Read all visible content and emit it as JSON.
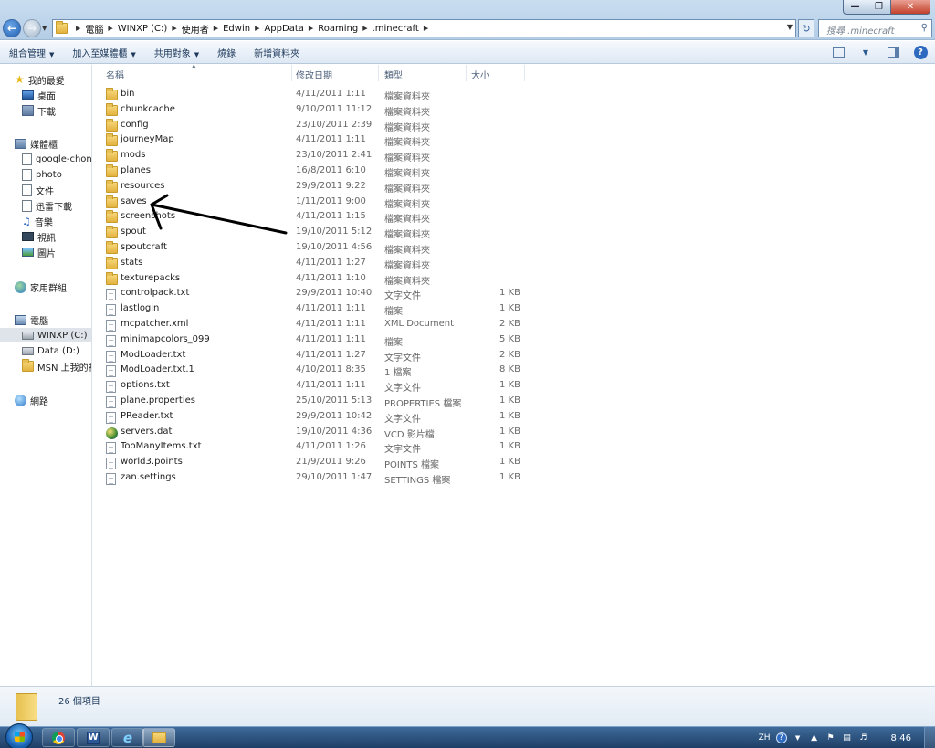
{
  "window": {
    "breadcrumb": [
      "電腦",
      "WINXP (C:)",
      "使用者",
      "Edwin",
      "AppData",
      "Roaming",
      ".minecraft"
    ],
    "search_placeholder": "搜尋 .minecraft"
  },
  "toolbar": {
    "organize": "組合管理",
    "add_to_library": "加入至媒體櫃",
    "share_with": "共用對象",
    "burn": "燒錄",
    "new_folder": "新增資料夾"
  },
  "nav": {
    "favorites": "我的最愛",
    "desktop": "桌面",
    "downloads": "下載",
    "libraries": "媒體櫃",
    "lib_items": [
      "google-chon",
      "photo",
      "文件",
      "迅雷下載",
      "音樂",
      "視訊",
      "圖片"
    ],
    "homegroup": "家用群組",
    "computer": "電腦",
    "drives": [
      "WINXP (C:)",
      "Data (D:)",
      "MSN 上我的社"
    ],
    "network": "網路"
  },
  "columns": {
    "name": "名稱",
    "date": "修改日期",
    "type": "類型",
    "size": "大小"
  },
  "files": [
    {
      "icon": "folder-icon",
      "name": "bin",
      "date": "4/11/2011 1:11",
      "type": "檔案資料夾",
      "size": ""
    },
    {
      "icon": "folder-icon",
      "name": "chunkcache",
      "date": "9/10/2011 11:12",
      "type": "檔案資料夾",
      "size": ""
    },
    {
      "icon": "folder-icon",
      "name": "config",
      "date": "23/10/2011 2:39",
      "type": "檔案資料夾",
      "size": ""
    },
    {
      "icon": "folder-icon",
      "name": "journeyMap",
      "date": "4/11/2011 1:11",
      "type": "檔案資料夾",
      "size": ""
    },
    {
      "icon": "folder-icon",
      "name": "mods",
      "date": "23/10/2011 2:41",
      "type": "檔案資料夾",
      "size": ""
    },
    {
      "icon": "folder-icon",
      "name": "planes",
      "date": "16/8/2011 6:10",
      "type": "檔案資料夾",
      "size": ""
    },
    {
      "icon": "folder-icon",
      "name": "resources",
      "date": "29/9/2011 9:22",
      "type": "檔案資料夾",
      "size": ""
    },
    {
      "icon": "folder-icon",
      "name": "saves",
      "date": "1/11/2011 9:00",
      "type": "檔案資料夾",
      "size": ""
    },
    {
      "icon": "folder-icon",
      "name": "screenshots",
      "date": "4/11/2011 1:15",
      "type": "檔案資料夾",
      "size": ""
    },
    {
      "icon": "folder-icon",
      "name": "spout",
      "date": "19/10/2011 5:12",
      "type": "檔案資料夾",
      "size": ""
    },
    {
      "icon": "folder-icon",
      "name": "spoutcraft",
      "date": "19/10/2011 4:56",
      "type": "檔案資料夾",
      "size": ""
    },
    {
      "icon": "folder-icon",
      "name": "stats",
      "date": "4/11/2011 1:27",
      "type": "檔案資料夾",
      "size": ""
    },
    {
      "icon": "folder-icon",
      "name": "texturepacks",
      "date": "4/11/2011 1:10",
      "type": "檔案資料夾",
      "size": ""
    },
    {
      "icon": "file-icon",
      "name": "controlpack.txt",
      "date": "29/9/2011 10:40",
      "type": "文字文件",
      "size": "1 KB"
    },
    {
      "icon": "file-icon",
      "name": "lastlogin",
      "date": "4/11/2011 1:11",
      "type": "檔案",
      "size": "1 KB"
    },
    {
      "icon": "file-icon",
      "name": "mcpatcher.xml",
      "date": "4/11/2011 1:11",
      "type": "XML Document",
      "size": "2 KB"
    },
    {
      "icon": "file-icon",
      "name": "minimapcolors_099",
      "date": "4/11/2011 1:11",
      "type": "檔案",
      "size": "5 KB"
    },
    {
      "icon": "file-icon",
      "name": "ModLoader.txt",
      "date": "4/11/2011 1:27",
      "type": "文字文件",
      "size": "2 KB"
    },
    {
      "icon": "file-icon",
      "name": "ModLoader.txt.1",
      "date": "4/10/2011 8:35",
      "type": "1 檔案",
      "size": "8 KB"
    },
    {
      "icon": "file-icon",
      "name": "options.txt",
      "date": "4/11/2011 1:11",
      "type": "文字文件",
      "size": "1 KB"
    },
    {
      "icon": "file-icon",
      "name": "plane.properties",
      "date": "25/10/2011 5:13",
      "type": "PROPERTIES 檔案",
      "size": "1 KB"
    },
    {
      "icon": "file-icon",
      "name": "PReader.txt",
      "date": "29/9/2011 10:42",
      "type": "文字文件",
      "size": "1 KB"
    },
    {
      "icon": "media-icon",
      "name": "servers.dat",
      "date": "19/10/2011 4:36",
      "type": "VCD 影片檔",
      "size": "1 KB"
    },
    {
      "icon": "file-icon",
      "name": "TooManyItems.txt",
      "date": "4/11/2011 1:26",
      "type": "文字文件",
      "size": "1 KB"
    },
    {
      "icon": "file-icon",
      "name": "world3.points",
      "date": "21/9/2011 9:26",
      "type": "POINTS 檔案",
      "size": "1 KB"
    },
    {
      "icon": "file-icon",
      "name": "zan.settings",
      "date": "29/10/2011 1:47",
      "type": "SETTINGS 檔案",
      "size": "1 KB"
    }
  ],
  "status": {
    "item_count": "26 個項目"
  },
  "taskbar": {
    "lang": "ZH",
    "clock": "8:46"
  }
}
